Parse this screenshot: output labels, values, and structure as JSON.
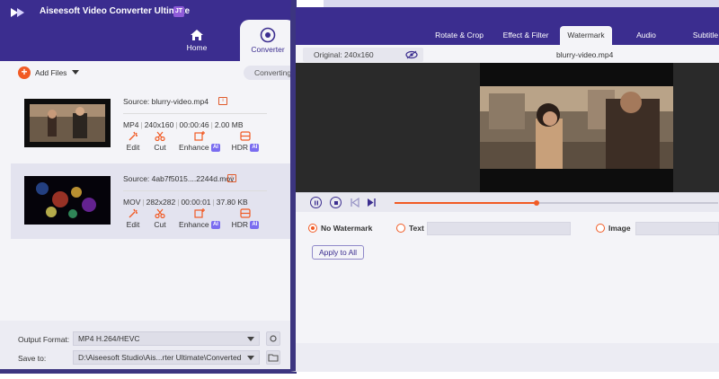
{
  "app": {
    "title": "Aiseesoft Video Converter Ultimate",
    "badge": "JT",
    "nav": {
      "home": "Home",
      "converter": "Converter"
    },
    "toolbar": {
      "add_files": "Add Files",
      "converting": "Converting"
    },
    "files": [
      {
        "source": "Source: blurry-video.mp4",
        "format": "MP4",
        "resolution": "240x160",
        "duration": "00:00:46",
        "size": "2.00 MB",
        "tools": {
          "edit": "Edit",
          "cut": "Cut",
          "enhance": "Enhance",
          "hdr": "HDR",
          "ai": "AI"
        }
      },
      {
        "source": "Source: 4ab7f5015....2244d.mov",
        "format": "MOV",
        "resolution": "282x282",
        "duration": "00:00:01",
        "size": "37.80 KB",
        "tools": {
          "edit": "Edit",
          "cut": "Cut",
          "enhance": "Enhance",
          "hdr": "HDR",
          "ai": "AI"
        }
      }
    ],
    "bottom": {
      "output_label": "Output Format:",
      "output_value": "MP4 H.264/HEVC",
      "save_label": "Save to:",
      "save_value": "D:\\Aiseesoft Studio\\Ais...rter Ultimate\\Converted"
    },
    "colors": {
      "header": "#3b2d8f",
      "accent": "#f15a24",
      "ai_badge": "#7a6cf0"
    }
  },
  "editor": {
    "tabs": [
      "Rotate & Crop",
      "Effect & Filter",
      "Watermark",
      "Audio",
      "Subtitle"
    ],
    "active_tab": "Watermark",
    "original": "Original: 240x160",
    "video_name": "blurry-video.mp4",
    "progress": 0.44,
    "watermark": {
      "none": "No Watermark",
      "text": "Text",
      "image": "Image",
      "selected": "No Watermark"
    },
    "apply_all": "Apply to All"
  }
}
